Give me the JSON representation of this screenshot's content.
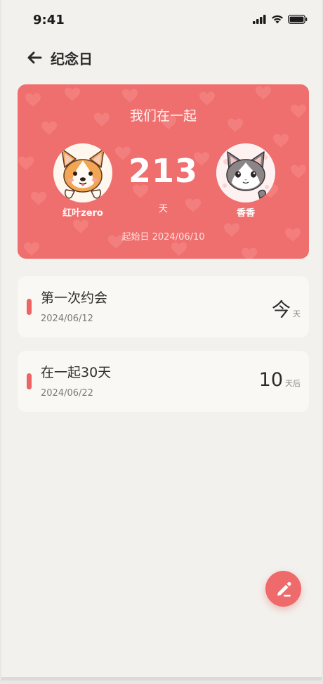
{
  "status_bar": {
    "time": "9:41"
  },
  "header": {
    "title": "纪念日",
    "back_icon": "arrow-left-icon"
  },
  "hero": {
    "title": "我们在一起",
    "days": "213",
    "days_unit": "天",
    "start_label": "起始日 2024/06/10",
    "person_left": {
      "name": "红叶zero",
      "avatar": "corgi-avatar"
    },
    "person_right": {
      "name": "香香",
      "avatar": "cat-avatar"
    },
    "colors": {
      "background": "#ef6e6e",
      "hearts": "#f48582"
    }
  },
  "events": [
    {
      "title": "第一次约会",
      "date": "2024/06/12",
      "count": "今",
      "unit": "天"
    },
    {
      "title": "在一起30天",
      "date": "2024/06/22",
      "count": "10",
      "unit": "天后"
    }
  ],
  "fab": {
    "icon": "pencil-edit-icon",
    "color": "#ef6b6b"
  },
  "accent_color": "#ec6464"
}
